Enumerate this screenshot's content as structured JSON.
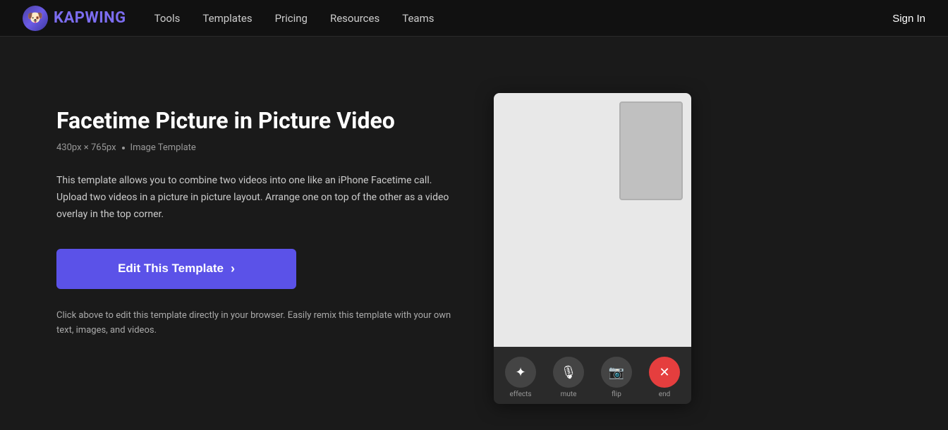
{
  "navbar": {
    "logo_text": "KAPWING",
    "logo_emoji": "🐶",
    "nav_items": [
      {
        "label": "Tools",
        "href": "#"
      },
      {
        "label": "Templates",
        "href": "#"
      },
      {
        "label": "Pricing",
        "href": "#"
      },
      {
        "label": "Resources",
        "href": "#"
      },
      {
        "label": "Teams",
        "href": "#"
      }
    ],
    "sign_in_label": "Sign In"
  },
  "main": {
    "title": "Facetime Picture in Picture Video",
    "meta_dimensions": "430px × 765px",
    "meta_type": "Image Template",
    "description": "This template allows you to combine two videos into one like an iPhone Facetime call. Upload two videos in a picture in picture layout. Arrange one on top of the other as a video overlay in the top corner.",
    "cta_button": "Edit This Template",
    "bottom_note": "Click above to edit this template directly in your browser. Easily remix this template with your own text, images, and videos."
  },
  "preview_controls": [
    {
      "icon": "✦",
      "label": "effects"
    },
    {
      "icon": "🎙",
      "label": "mute"
    },
    {
      "icon": "📷",
      "label": "flip"
    },
    {
      "icon": "✕",
      "label": "end",
      "is_red": true
    }
  ]
}
